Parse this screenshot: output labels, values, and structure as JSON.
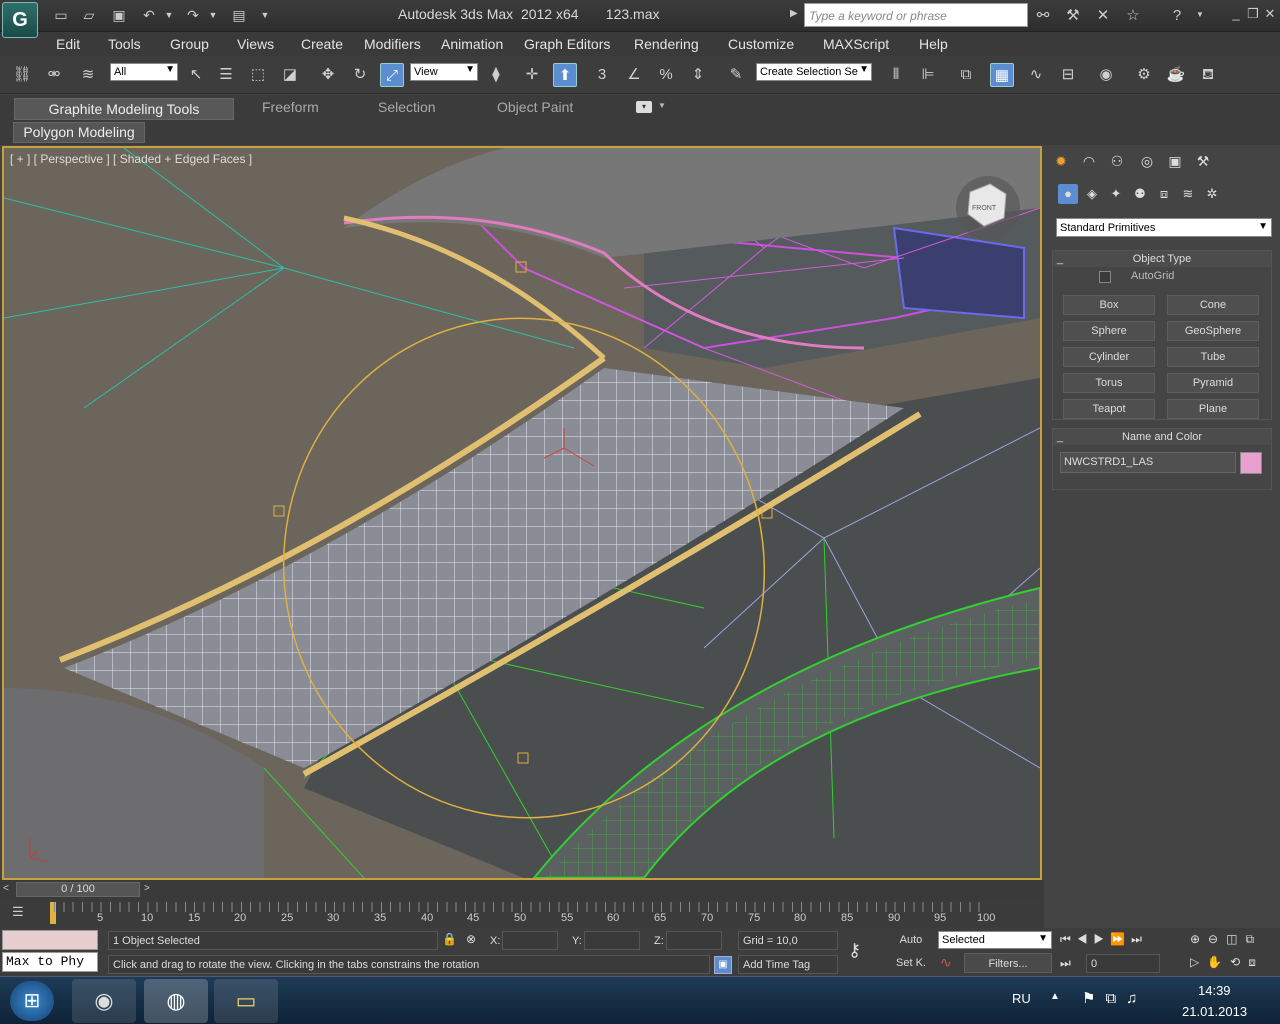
{
  "titlebar": {
    "app_badge": "G",
    "title": "Autodesk 3ds Max  2012 x64       123.max",
    "search_placeholder": "Type a keyword or phrase",
    "icons": [
      "binoculars-icon",
      "wrench-icon",
      "star-cross-icon",
      "star-icon",
      "help-icon"
    ]
  },
  "menu": [
    "Edit",
    "Tools",
    "Group",
    "Views",
    "Create",
    "Modifiers",
    "Animation",
    "Graph Editors",
    "Rendering",
    "Customize",
    "MAXScript",
    "Help"
  ],
  "toolbar": {
    "selection_filter": "All",
    "reference_coord": "View",
    "named_selection": "Create Selection Se",
    "snap_label": "3"
  },
  "ribbon": {
    "tabs": [
      "Graphite Modeling Tools",
      "Freeform",
      "Selection",
      "Object Paint"
    ],
    "subtab": "Polygon Modeling"
  },
  "viewport": {
    "label": "[ + ] [ Perspective ] [ Shaded + Edged Faces ]",
    "viewcube_label": "FRONT"
  },
  "command_panel": {
    "category": "Standard Primitives",
    "object_type_title": "Object Type",
    "autogrid_label": "AutoGrid",
    "primitives": [
      "Box",
      "Cone",
      "Sphere",
      "GeoSphere",
      "Cylinder",
      "Tube",
      "Torus",
      "Pyramid",
      "Teapot",
      "Plane"
    ],
    "name_color_title": "Name and Color",
    "object_name": "NWCSTRD1_LAS",
    "object_color": "#e8a0d0"
  },
  "timeline": {
    "slider_label": "0 / 100",
    "ticks": [
      "5",
      "10",
      "15",
      "20",
      "25",
      "30",
      "35",
      "40",
      "45",
      "50",
      "55",
      "60",
      "65",
      "70",
      "75",
      "80",
      "85",
      "90",
      "95",
      "100"
    ]
  },
  "status": {
    "maxscript_text": "Max to Phy",
    "selection_info": "1 Object Selected",
    "prompt": "Click and drag to rotate the view.  Clicking in the tabs constrains the rotation",
    "x_label": "X:",
    "y_label": "Y:",
    "z_label": "Z:",
    "grid": "Grid = 10,0",
    "add_time_tag": "Add Time Tag",
    "auto_key": "Auto",
    "set_key": "Set K.",
    "key_mode": "Selected",
    "filters": "Filters...",
    "frame": "0"
  },
  "taskbar": {
    "language": "RU",
    "time": "14:39",
    "date": "21.01.2013"
  }
}
